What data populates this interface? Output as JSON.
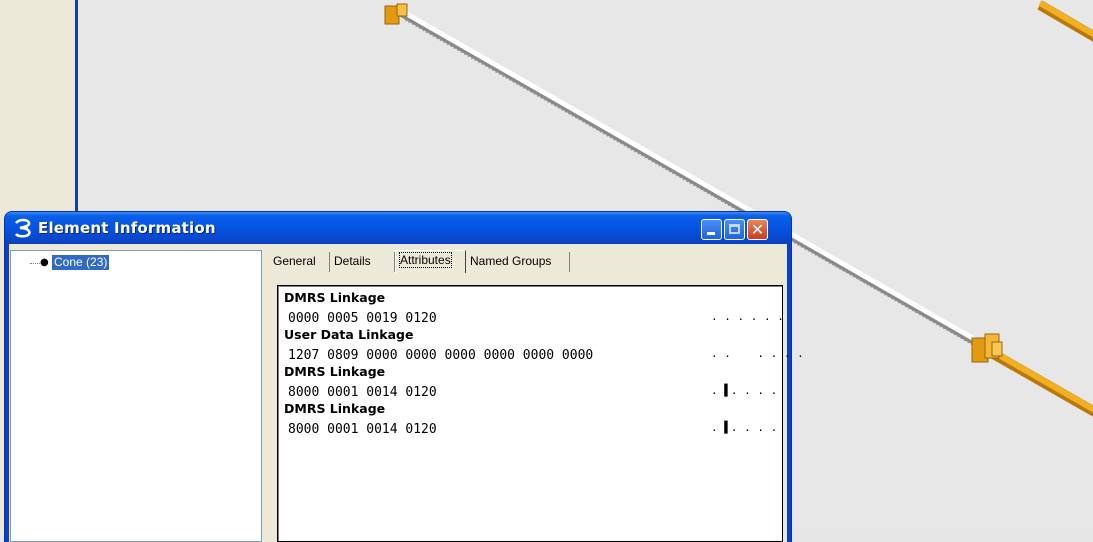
{
  "window": {
    "title": "Element Information",
    "controls": {
      "minimize": "minimize",
      "maximize": "maximize",
      "close": "✕"
    }
  },
  "tree": {
    "items": [
      {
        "label": "Cone (23)",
        "selected": true
      }
    ]
  },
  "tabs": [
    {
      "label": "General"
    },
    {
      "label": "Details"
    },
    {
      "label": "Attributes",
      "active": true
    },
    {
      "label": "Named Groups"
    }
  ],
  "attributes": {
    "entries": [
      {
        "title": "DMRS Linkage",
        "hex": "0000 0005 0019 0120",
        "ascii": ". . . . . ."
      },
      {
        "title": "User Data Linkage",
        "hex": "1207 0809 0000 0000 0000 0000 0000 0000",
        "ascii": ". .    . . . ."
      },
      {
        "title": "DMRS Linkage",
        "hex": "8000 0001 0014 0120",
        "ascii": ". ▌. . . ."
      },
      {
        "title": "DMRS Linkage",
        "hex": "8000 0001 0014 0120",
        "ascii": ". ▌. . . ."
      }
    ]
  },
  "colors": {
    "titlebar": "#0554e2",
    "selection": "#316ac5",
    "close_button": "#c73e1d",
    "pipe_orange": "#e8a317"
  }
}
